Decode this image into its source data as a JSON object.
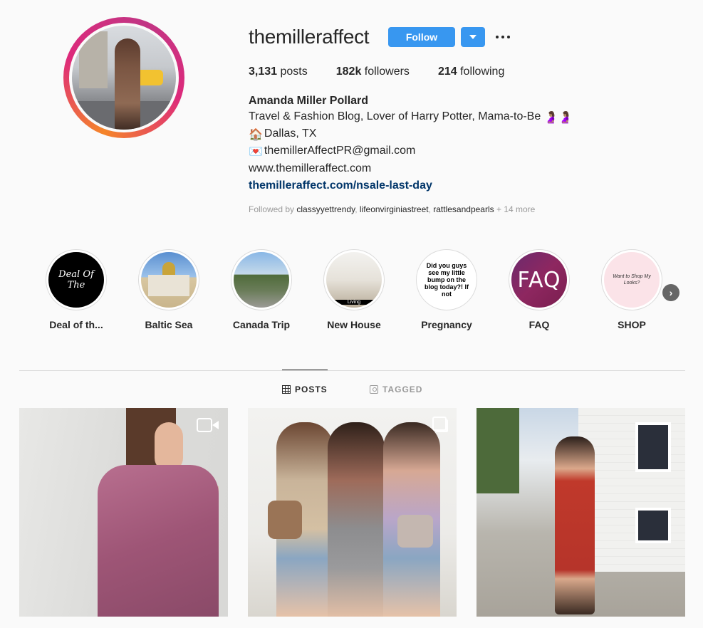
{
  "profile": {
    "username": "themilleraffect",
    "follow_label": "Follow",
    "stats": {
      "posts_count": "3,131",
      "posts_label": "posts",
      "followers_count": "182k",
      "followers_label": "followers",
      "following_count": "214",
      "following_label": "following"
    },
    "full_name": "Amanda Miller Pollard",
    "bio": {
      "line1": "Travel & Fashion Blog, Lover of Harry Potter, Mama-to-Be",
      "line1_emoji": "🤰🏽🤰🏽",
      "line2_emoji": "🏠",
      "line2": "Dallas, TX",
      "line3_emoji": "💌",
      "line3": "themillerAffectPR@gmail.com",
      "line4": "www.themilleraffect.com",
      "link": "themilleraffect.com/nsale-last-day"
    },
    "followed_by": {
      "prefix": "Followed by",
      "accounts": [
        "classyyettrendy",
        "lifeonvirginiastreet",
        "rattlesandpearls"
      ],
      "more": "+ 14 more"
    }
  },
  "highlights": [
    {
      "label": "Deal of th...",
      "cover_text": "Deal Of The"
    },
    {
      "label": "Baltic Sea"
    },
    {
      "label": "Canada Trip"
    },
    {
      "label": "New House",
      "cover_text": "Living"
    },
    {
      "label": "Pregnancy",
      "cover_text": "Did you guys see my little bump on the blog today?! If not"
    },
    {
      "label": "FAQ",
      "cover_text": "FAQ"
    },
    {
      "label": "SHOP",
      "cover_text": "Want to Shop My Looks?"
    }
  ],
  "tabs": [
    {
      "label": "POSTS",
      "icon": "grid-icon",
      "active": true
    },
    {
      "label": "TAGGED",
      "icon": "tagged-icon",
      "active": false
    }
  ],
  "posts": [
    {
      "type": "video",
      "icon": "video-icon"
    },
    {
      "type": "carousel",
      "icon": "multiple-icon"
    },
    {
      "type": "photo"
    }
  ],
  "colors": {
    "accent": "#3897f0",
    "link": "#003569",
    "background": "#fafafa",
    "text": "#262626",
    "muted": "#999999"
  }
}
